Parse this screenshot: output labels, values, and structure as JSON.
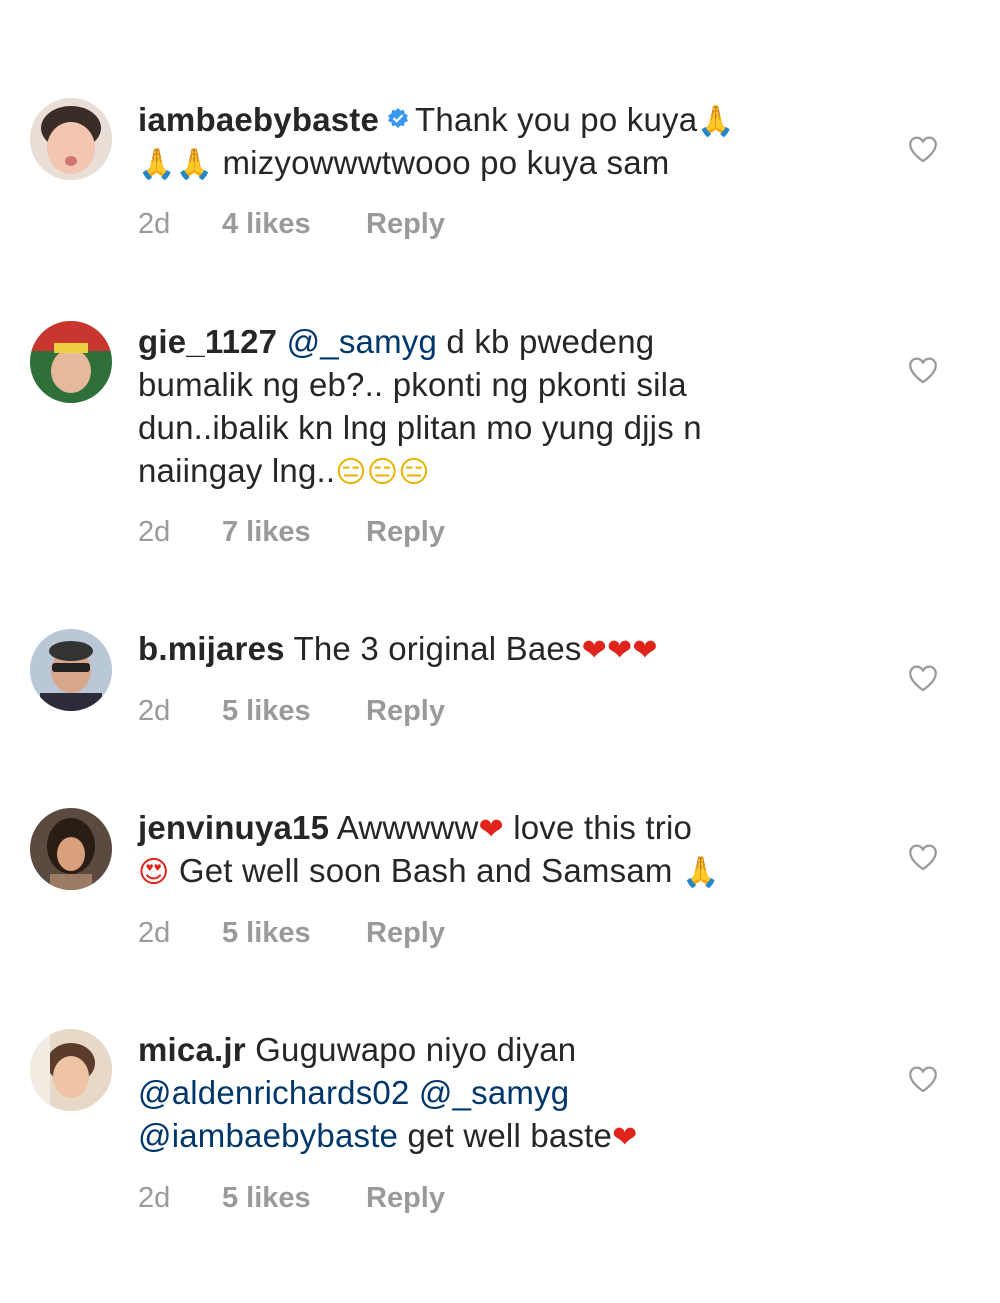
{
  "comments": [
    {
      "username": "iambaebybaste",
      "verified": true,
      "line1": "Thank you po kuya",
      "line1_emoji": "🙏",
      "line2_emoji": "🙏🙏",
      "line2": " mizyowwwtwooo po kuya sam",
      "timestamp": "2d",
      "likes": "4 likes",
      "reply": "Reply"
    },
    {
      "username": "gie_1127",
      "mention": "@_samyg",
      "line1": " d kb pwedeng",
      "line2": "bumalik ng eb?.. pkonti ng pkonti sila",
      "line3": "dun..ibalik kn lng plitan mo yung djjs n",
      "line4": "naiingay lng..",
      "line4_emoji": "😑😑😑",
      "timestamp": "2d",
      "likes": "7 likes",
      "reply": "Reply"
    },
    {
      "username": "b.mijares",
      "line1": "The 3 original Baes",
      "line1_emoji": "❤❤❤",
      "timestamp": "2d",
      "likes": "5 likes",
      "reply": "Reply"
    },
    {
      "username": "jenvinuya15",
      "line1": "Awwwww",
      "line1_emoji": "❤",
      "line1b": " love this trio",
      "line2_emoji": "😍",
      "line2": " Get well soon Bash and Samsam ",
      "line2_emoji_end": "🙏",
      "timestamp": "2d",
      "likes": "5 likes",
      "reply": "Reply"
    },
    {
      "username": "mica.jr",
      "line1": "Guguwapo niyo diyan",
      "mention1": "@aldenrichards02",
      "mention2": "@_samyg",
      "mention3": "@iambaebybaste",
      "line3": " get well baste",
      "line3_emoji": "❤",
      "timestamp": "2d",
      "likes": "5 likes",
      "reply": "Reply"
    }
  ],
  "icons": {
    "like": "heart-outline-icon",
    "verified": "verified-badge-icon"
  },
  "colors": {
    "text": "#262626",
    "meta": "#9a9a9a",
    "mention": "#00376b",
    "verified": "#3897f0",
    "heart_emoji": "#e0231b"
  }
}
